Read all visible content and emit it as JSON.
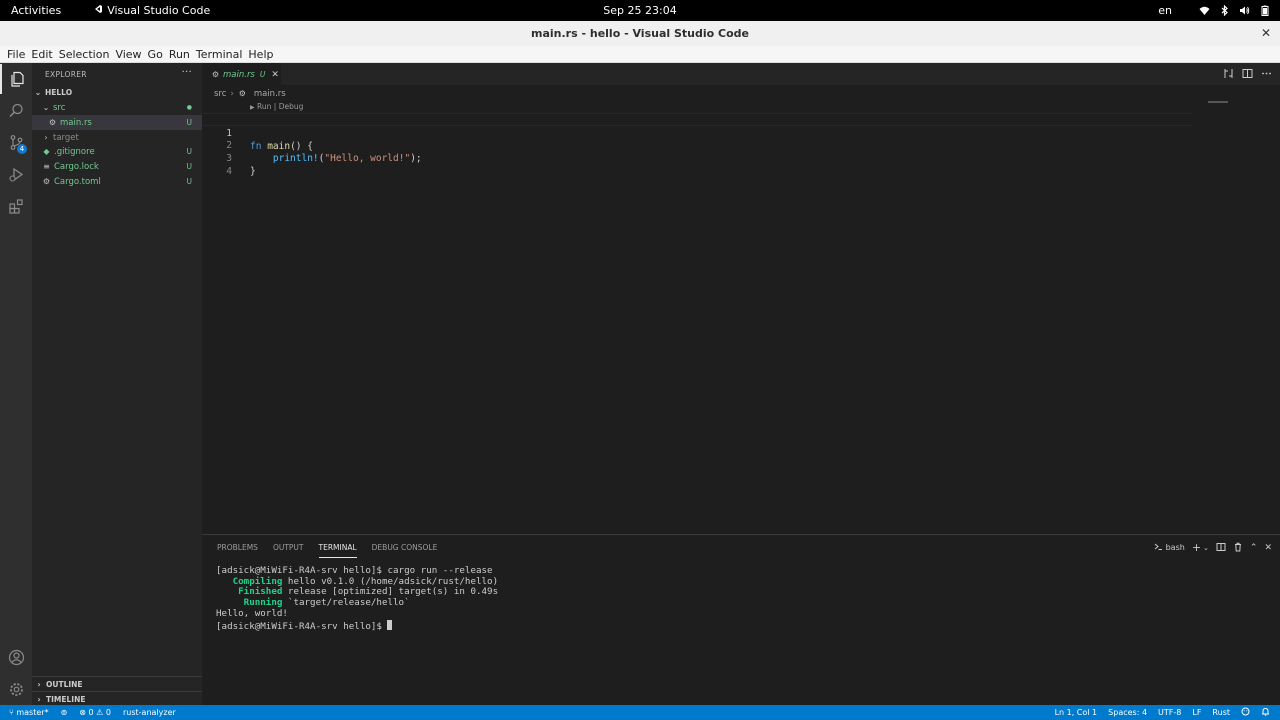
{
  "topbar": {
    "activities": "Activities",
    "app_name": "Visual Studio Code",
    "clock": "Sep 25  23:04",
    "lang": "en"
  },
  "window": {
    "title": "main.rs - hello - Visual Studio Code",
    "close": "✕"
  },
  "menu": [
    "File",
    "Edit",
    "Selection",
    "View",
    "Go",
    "Run",
    "Terminal",
    "Help"
  ],
  "activity_bar": {
    "scm_badge": "4"
  },
  "explorer": {
    "header": "EXPLORER",
    "more": "···",
    "folder": "HELLO",
    "items": [
      {
        "name": "src",
        "status": "●"
      },
      {
        "name": "main.rs",
        "status": "U"
      },
      {
        "name": "target",
        "status": ""
      },
      {
        "name": ".gitignore",
        "status": "U"
      },
      {
        "name": "Cargo.lock",
        "status": "U"
      },
      {
        "name": "Cargo.toml",
        "status": "U"
      }
    ],
    "outline": "OUTLINE",
    "timeline": "TIMELINE"
  },
  "editor": {
    "tab_label": "main.rs",
    "tab_status": "U",
    "tab_close": "✕",
    "breadcrumb": [
      "src",
      "main.rs"
    ],
    "codelens_run": "Run",
    "codelens_sep": " | ",
    "codelens_debug": "Debug",
    "line_numbers": [
      "1",
      "2",
      "3",
      "4"
    ],
    "code": {
      "l1_kw": "fn",
      "l1_fn": "main",
      "l1_rest": "() {",
      "l2_indent": "    ",
      "l2_macro": "println!",
      "l2_open": "(",
      "l2_str": "\"Hello, world!\"",
      "l2_close": ");",
      "l3": "}"
    }
  },
  "panel": {
    "tabs": [
      "PROBLEMS",
      "OUTPUT",
      "TERMINAL",
      "DEBUG CONSOLE"
    ],
    "active_tab": "TERMINAL",
    "shell": "bash",
    "terminal": {
      "l1": "[adsick@MiWiFi-R4A-srv hello]$ cargo run --release",
      "l2_key": "   Compiling",
      "l2_rest": " hello v0.1.0 (/home/adsick/rust/hello)",
      "l3_key": "    Finished",
      "l3_rest": " release [optimized] target(s) in 0.49s",
      "l4_key": "     Running",
      "l4_rest": " `target/release/hello`",
      "l5": "Hello, world!",
      "l6": "[adsick@MiWiFi-R4A-srv hello]$ "
    }
  },
  "statusbar": {
    "branch": "master*",
    "errors": "0",
    "warnings": "0",
    "analyzer": "rust-analyzer",
    "position": "Ln 1, Col 1",
    "spaces": "Spaces: 4",
    "encoding": "UTF-8",
    "eol": "LF",
    "language": "Rust"
  }
}
